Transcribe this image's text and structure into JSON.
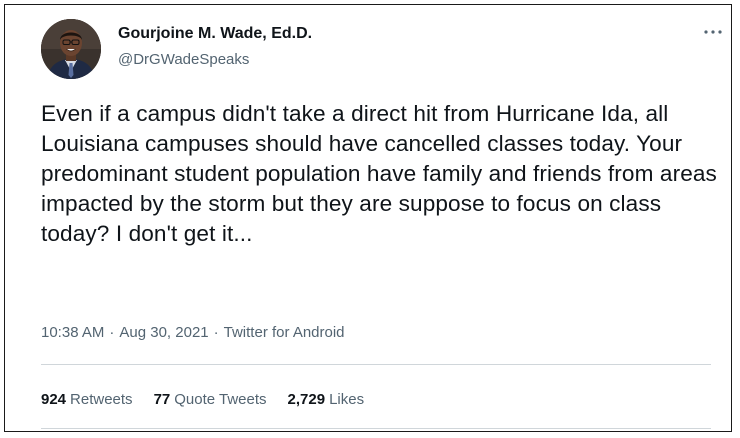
{
  "author": {
    "name": "Gourjoine M. Wade, Ed.D.",
    "handle": "@DrGWadeSpeaks",
    "avatar_icon": "profile-photo"
  },
  "menu_icon": "more-options-icon",
  "tweet": {
    "text": "Even if a campus didn't take a direct hit from Hurricane Ida, all Louisiana campuses should have cancelled classes today. Your predominant student population have family and friends from areas impacted by the storm but they are suppose to focus on class today? I don't get it...",
    "time": "10:38 AM",
    "date": "Aug 30, 2021",
    "separator": "·",
    "source": "Twitter for Android"
  },
  "stats": {
    "retweets_count": "924",
    "retweets_label": "Retweets",
    "quotes_count": "77",
    "quotes_label": "Quote Tweets",
    "likes_count": "2,729",
    "likes_label": "Likes"
  },
  "colors": {
    "text_primary": "#0f1419",
    "text_secondary": "#536471",
    "border": "#1a1a1a",
    "divider": "#d0d6da"
  }
}
